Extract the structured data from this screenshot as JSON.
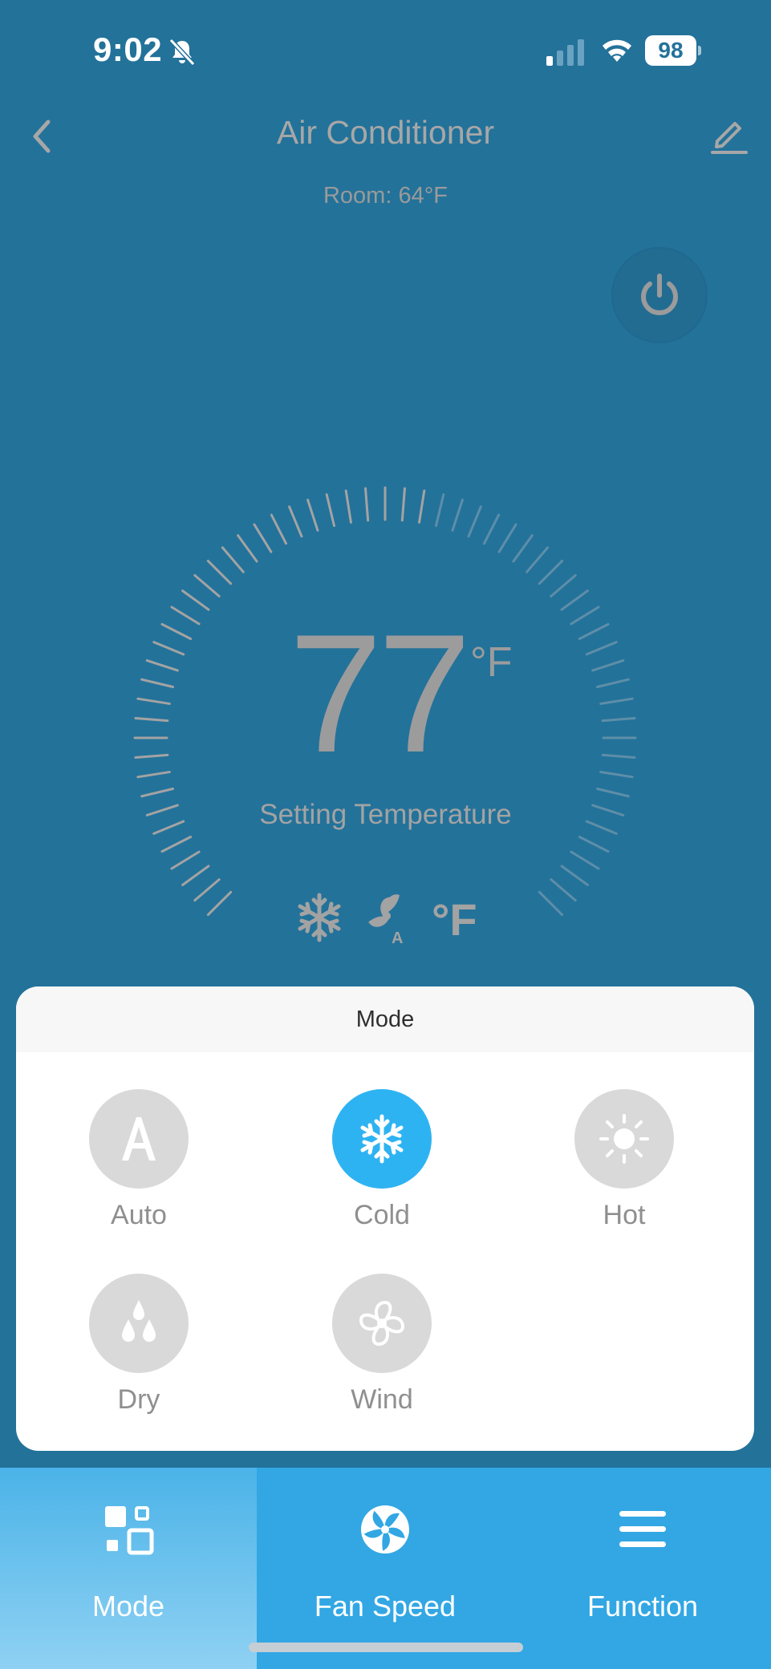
{
  "status_bar": {
    "time": "9:02",
    "battery": "98"
  },
  "header": {
    "title": "Air Conditioner",
    "room": "Room: 64°F"
  },
  "thermostat": {
    "temperature": "77",
    "unit": "°F",
    "label": "Setting Temperature",
    "status_icons": [
      "snowflake-icon",
      "fan-auto-icon",
      "fahrenheit-icon"
    ],
    "status_unit": "°F"
  },
  "mode_sheet": {
    "title": "Mode",
    "options": [
      {
        "label": "Auto",
        "icon": "auto-a-icon",
        "selected": false
      },
      {
        "label": "Cold",
        "icon": "snowflake-icon",
        "selected": true
      },
      {
        "label": "Hot",
        "icon": "sun-icon",
        "selected": false
      },
      {
        "label": "Dry",
        "icon": "droplets-icon",
        "selected": false
      },
      {
        "label": "Wind",
        "icon": "fan-icon",
        "selected": false
      }
    ]
  },
  "bottom_tabs": [
    {
      "label": "Mode",
      "icon": "mode-grid-icon",
      "active": true
    },
    {
      "label": "Fan Speed",
      "icon": "fan-speed-icon",
      "active": false
    },
    {
      "label": "Function",
      "icon": "menu-icon",
      "active": false
    }
  ],
  "colors": {
    "background": "#23729a",
    "accent": "#2eb3f2",
    "tab_bar": "#32a7e4",
    "muted_text": "#a7a7a7"
  }
}
